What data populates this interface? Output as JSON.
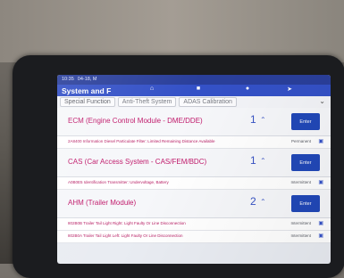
{
  "status_bar": {
    "time": "10:35",
    "date": "04-18, M"
  },
  "header": {
    "title": "System and F",
    "icons": [
      "home-icon",
      "document-icon",
      "user-icon",
      "arrow-icon"
    ]
  },
  "tabs": [
    {
      "label": "Special Function"
    },
    {
      "label": "Anti-Theft System"
    },
    {
      "label": "ADAS Calibration"
    }
  ],
  "modules": [
    {
      "name": "ECM (Engine Control Module - DME/DDE)",
      "count": "1",
      "enter_label": "Enter",
      "faults": [
        {
          "text": "2A8400 Information Diesel Particulate Filter: Limited Remaining Distance Available",
          "status": "Permanent"
        }
      ]
    },
    {
      "name": "CAS (Car Access System - CAS/FEM/BDC)",
      "count": "1",
      "enter_label": "Enter",
      "faults": [
        {
          "text": "A0B0E5 Identification Transmitter: Undervoltage, Battery",
          "status": "Intermittent"
        }
      ]
    },
    {
      "name": "AHM (Trailer Module)",
      "count": "2",
      "enter_label": "Enter",
      "faults": [
        {
          "text": "802B0B Trailer Tail Light Right: Light Faulty Or Line Disconnection",
          "status": "Intermittent"
        },
        {
          "text": "802B0A Trailer Tail Light Left: Light Faulty Or Line Disconnection",
          "status": "Intermittent"
        }
      ]
    }
  ]
}
